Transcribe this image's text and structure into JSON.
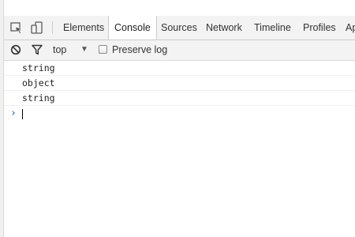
{
  "devtools": {
    "tabs": [
      {
        "label": "Elements"
      },
      {
        "label": "Console",
        "selected": true
      },
      {
        "label": "Sources"
      },
      {
        "label": "Network"
      },
      {
        "label": "Timeline"
      },
      {
        "label": "Profiles"
      },
      {
        "label": "Ap"
      }
    ],
    "icons": {
      "inspect": "inspect-element-icon",
      "device": "device-mode-icon",
      "clear": "clear-console-icon",
      "filter": "filter-icon",
      "dropdown": "dropdown-arrow-icon"
    }
  },
  "console_toolbar": {
    "context": "top",
    "dropdown_arrow": "▼",
    "preserve_log_label": "Preserve log",
    "preserve_log_checked": false
  },
  "console": {
    "messages": [
      "string",
      "object",
      "string"
    ],
    "prompt_symbol": "›",
    "input_value": ""
  },
  "colors": {
    "toolbar_bg": "#f3f3f3",
    "border": "#cccccc",
    "prompt": "#367cf1"
  }
}
